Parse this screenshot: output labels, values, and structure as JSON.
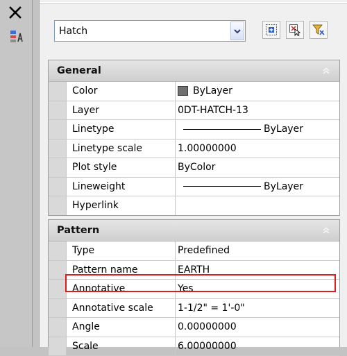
{
  "window": {
    "close_icon": "close-icon",
    "side_icon": "quick-properties-icon"
  },
  "selector": {
    "value": "Hatch"
  },
  "toolbar": {
    "buttons": [
      {
        "icon": "toggle-pickadd-icon"
      },
      {
        "icon": "select-objects-icon"
      },
      {
        "icon": "quick-select-icon"
      }
    ]
  },
  "general": {
    "title": "General",
    "rows": [
      {
        "label": "Color",
        "value": "ByLayer"
      },
      {
        "label": "Layer",
        "value": "0DT-HATCH-13"
      },
      {
        "label": "Linetype",
        "value": "ByLayer"
      },
      {
        "label": "Linetype scale",
        "value": "1.00000000"
      },
      {
        "label": "Plot style",
        "value": "ByColor"
      },
      {
        "label": "Lineweight",
        "value": "ByLayer"
      },
      {
        "label": "Hyperlink",
        "value": ""
      }
    ]
  },
  "pattern": {
    "title": "Pattern",
    "rows": [
      {
        "label": "Type",
        "value": "Predefined"
      },
      {
        "label": "Pattern name",
        "value": "EARTH"
      },
      {
        "label": "Annotative",
        "value": "Yes"
      },
      {
        "label": "Annotative scale",
        "value": "1-1/2\" = 1'-0\""
      },
      {
        "label": "Angle",
        "value": "0.00000000"
      },
      {
        "label": "Scale",
        "value": "6.00000000"
      }
    ]
  },
  "colors": {
    "highlight": "#e31a1a",
    "color_swatch": "#707070"
  }
}
